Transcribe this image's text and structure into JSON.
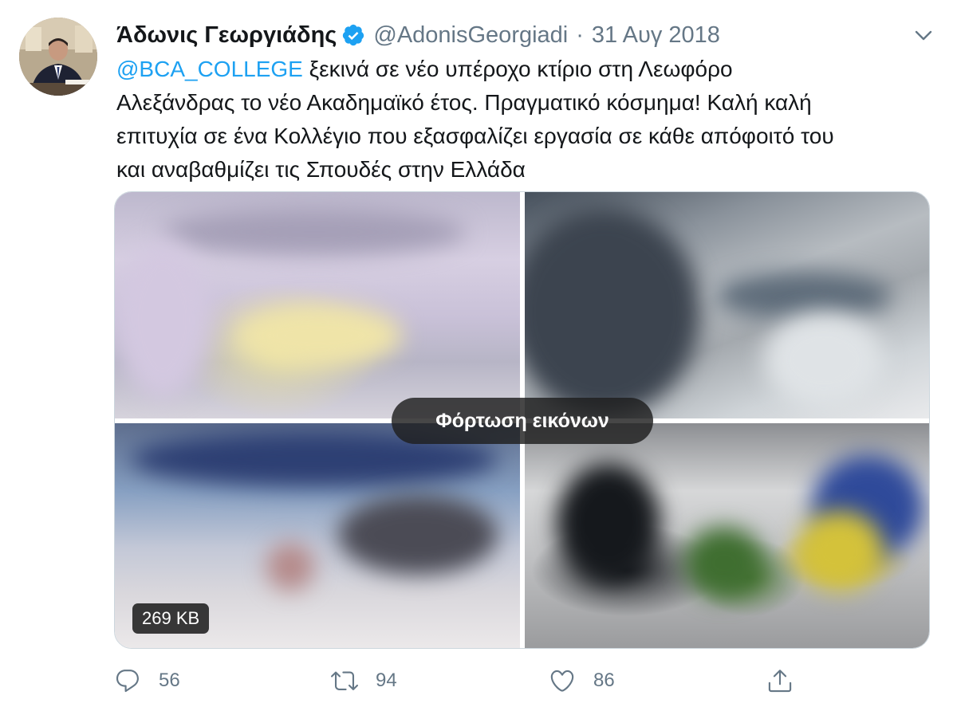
{
  "author": {
    "name": "Άδωνις Γεωργιάδης",
    "handle": "@AdonisGeorgiadi",
    "date": "31 Αυγ 2018",
    "verified": true,
    "separator": "·"
  },
  "tweet": {
    "mention": "@BCA_COLLEGE",
    "line1_rest": " ξεκινά σε νέο υπέροχο κτίριο στη Λεωφόρο",
    "line2": "Αλεξάνδρας το νέο Ακαδημαϊκό έτος. Πραγματικό κόσμημα! Καλή καλή",
    "line3": "επιτυχία σε ένα Κολλέγιο που εξασφαλίζει εργασία σε κάθε απόφοιτό του",
    "line4": "και αναβαθμίζει τις Σπουδές στην Ελλάδα"
  },
  "media": {
    "load_label": "Φόρτωση εικόνων",
    "size_label": "269 KB",
    "image_count": 4
  },
  "actions": {
    "reply_count": "56",
    "retweet_count": "94",
    "like_count": "86"
  },
  "icons": {
    "verified": "verified-badge-icon",
    "caret": "chevron-down-icon",
    "reply": "reply-bubble-icon",
    "retweet": "retweet-icon",
    "like": "heart-icon",
    "share": "share-upload-icon"
  },
  "colors": {
    "link": "#1da1f2",
    "secondary_text": "#657786",
    "primary_text": "#14171a"
  }
}
